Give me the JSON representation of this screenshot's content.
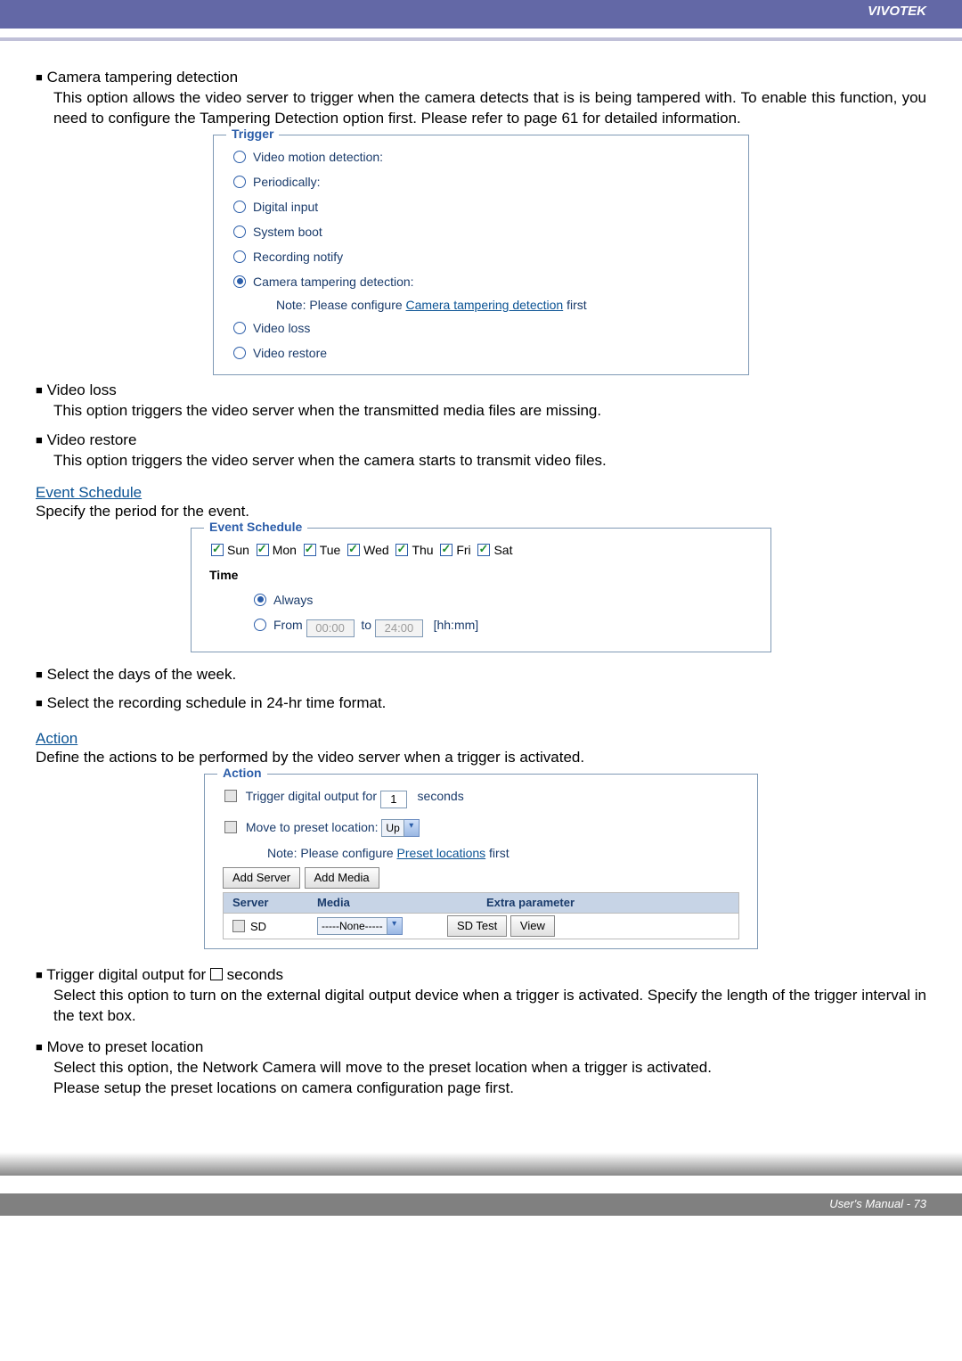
{
  "header": {
    "brand": "VIVOTEK"
  },
  "section_tampering": {
    "title": "Camera tampering detection",
    "body": "This option allows the video server to trigger when the camera detects that is is being tampered with. To enable this function, you need to configure the Tampering Detection option first. Please refer to page 61 for detailed information."
  },
  "trigger_box": {
    "legend": "Trigger",
    "opts": {
      "vmd": "Video motion detection:",
      "period": "Periodically:",
      "digin": "Digital input",
      "sysboot": "System boot",
      "recnotify": "Recording notify",
      "tamper": "Camera tampering detection:",
      "vloss": "Video loss",
      "vrestore": "Video restore"
    },
    "note_prefix": "Note: Please configure ",
    "note_link": "Camera tampering detection",
    "note_suffix": " first"
  },
  "videoloss": {
    "title": "Video loss",
    "body": "This option triggers the video server when the transmitted media files are missing."
  },
  "videorestore": {
    "title": "Video restore",
    "body": "This option triggers the video server when the camera starts to transmit video files."
  },
  "schedule": {
    "link": "Event Schedule",
    "intro": "Specify the period for the event.",
    "legend": "Event Schedule",
    "days": {
      "sun": "Sun",
      "mon": "Mon",
      "tue": "Tue",
      "wed": "Wed",
      "thu": "Thu",
      "fri": "Fri",
      "sat": "Sat"
    },
    "time_label": "Time",
    "always": "Always",
    "from": "From",
    "from_val": "00:00",
    "to": "to",
    "to_val": "24:00",
    "hhmm": "[hh:mm]",
    "sel_days": "Select the days of the week.",
    "sel_rec": "Select the recording schedule in 24-hr time format."
  },
  "action": {
    "link": "Action",
    "intro": "Define the actions to be performed by the video server when a trigger is activated.",
    "legend": "Action",
    "trg_prefix": "Trigger digital output for",
    "trg_val": "1",
    "trg_suffix": "seconds",
    "move_prefix": "Move to preset location:",
    "move_val": "Up",
    "note_prefix": "Note: Please configure ",
    "note_link": "Preset locations",
    "note_suffix": " first",
    "btn_add_server": "Add Server",
    "btn_add_media": "Add Media",
    "hdr_server": "Server",
    "hdr_media": "Media",
    "hdr_extra": "Extra parameter",
    "row_sd": "SD",
    "row_media": "-----None-----",
    "btn_sdtest": "SD Test",
    "btn_view": "View"
  },
  "trigger_out": {
    "title_pre": "Trigger digital output for ",
    "title_post": " seconds",
    "body": "Select this option to turn on the external digital output device when a trigger is activated. Specify the length of the trigger interval in the text box."
  },
  "move_preset": {
    "title": "Move to preset location",
    "line1": "Select this option, the Network Camera will move to the preset location when a trigger is activated.",
    "line2": "Please setup the preset locations on camera configuration page first."
  },
  "footer": {
    "text": "User's Manual - 73"
  }
}
